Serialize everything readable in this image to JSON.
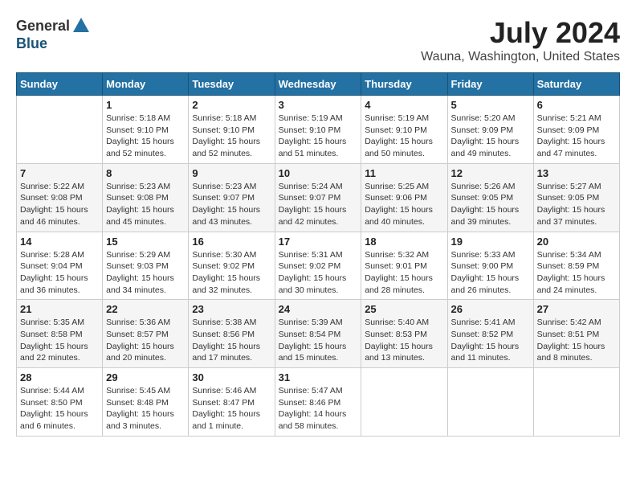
{
  "header": {
    "logo_general": "General",
    "logo_blue": "Blue",
    "month_title": "July 2024",
    "location": "Wauna, Washington, United States"
  },
  "weekdays": [
    "Sunday",
    "Monday",
    "Tuesday",
    "Wednesday",
    "Thursday",
    "Friday",
    "Saturday"
  ],
  "weeks": [
    [
      {
        "day": "",
        "info": ""
      },
      {
        "day": "1",
        "info": "Sunrise: 5:18 AM\nSunset: 9:10 PM\nDaylight: 15 hours\nand 52 minutes."
      },
      {
        "day": "2",
        "info": "Sunrise: 5:18 AM\nSunset: 9:10 PM\nDaylight: 15 hours\nand 52 minutes."
      },
      {
        "day": "3",
        "info": "Sunrise: 5:19 AM\nSunset: 9:10 PM\nDaylight: 15 hours\nand 51 minutes."
      },
      {
        "day": "4",
        "info": "Sunrise: 5:19 AM\nSunset: 9:10 PM\nDaylight: 15 hours\nand 50 minutes."
      },
      {
        "day": "5",
        "info": "Sunrise: 5:20 AM\nSunset: 9:09 PM\nDaylight: 15 hours\nand 49 minutes."
      },
      {
        "day": "6",
        "info": "Sunrise: 5:21 AM\nSunset: 9:09 PM\nDaylight: 15 hours\nand 47 minutes."
      }
    ],
    [
      {
        "day": "7",
        "info": "Sunrise: 5:22 AM\nSunset: 9:08 PM\nDaylight: 15 hours\nand 46 minutes."
      },
      {
        "day": "8",
        "info": "Sunrise: 5:23 AM\nSunset: 9:08 PM\nDaylight: 15 hours\nand 45 minutes."
      },
      {
        "day": "9",
        "info": "Sunrise: 5:23 AM\nSunset: 9:07 PM\nDaylight: 15 hours\nand 43 minutes."
      },
      {
        "day": "10",
        "info": "Sunrise: 5:24 AM\nSunset: 9:07 PM\nDaylight: 15 hours\nand 42 minutes."
      },
      {
        "day": "11",
        "info": "Sunrise: 5:25 AM\nSunset: 9:06 PM\nDaylight: 15 hours\nand 40 minutes."
      },
      {
        "day": "12",
        "info": "Sunrise: 5:26 AM\nSunset: 9:05 PM\nDaylight: 15 hours\nand 39 minutes."
      },
      {
        "day": "13",
        "info": "Sunrise: 5:27 AM\nSunset: 9:05 PM\nDaylight: 15 hours\nand 37 minutes."
      }
    ],
    [
      {
        "day": "14",
        "info": "Sunrise: 5:28 AM\nSunset: 9:04 PM\nDaylight: 15 hours\nand 36 minutes."
      },
      {
        "day": "15",
        "info": "Sunrise: 5:29 AM\nSunset: 9:03 PM\nDaylight: 15 hours\nand 34 minutes."
      },
      {
        "day": "16",
        "info": "Sunrise: 5:30 AM\nSunset: 9:02 PM\nDaylight: 15 hours\nand 32 minutes."
      },
      {
        "day": "17",
        "info": "Sunrise: 5:31 AM\nSunset: 9:02 PM\nDaylight: 15 hours\nand 30 minutes."
      },
      {
        "day": "18",
        "info": "Sunrise: 5:32 AM\nSunset: 9:01 PM\nDaylight: 15 hours\nand 28 minutes."
      },
      {
        "day": "19",
        "info": "Sunrise: 5:33 AM\nSunset: 9:00 PM\nDaylight: 15 hours\nand 26 minutes."
      },
      {
        "day": "20",
        "info": "Sunrise: 5:34 AM\nSunset: 8:59 PM\nDaylight: 15 hours\nand 24 minutes."
      }
    ],
    [
      {
        "day": "21",
        "info": "Sunrise: 5:35 AM\nSunset: 8:58 PM\nDaylight: 15 hours\nand 22 minutes."
      },
      {
        "day": "22",
        "info": "Sunrise: 5:36 AM\nSunset: 8:57 PM\nDaylight: 15 hours\nand 20 minutes."
      },
      {
        "day": "23",
        "info": "Sunrise: 5:38 AM\nSunset: 8:56 PM\nDaylight: 15 hours\nand 17 minutes."
      },
      {
        "day": "24",
        "info": "Sunrise: 5:39 AM\nSunset: 8:54 PM\nDaylight: 15 hours\nand 15 minutes."
      },
      {
        "day": "25",
        "info": "Sunrise: 5:40 AM\nSunset: 8:53 PM\nDaylight: 15 hours\nand 13 minutes."
      },
      {
        "day": "26",
        "info": "Sunrise: 5:41 AM\nSunset: 8:52 PM\nDaylight: 15 hours\nand 11 minutes."
      },
      {
        "day": "27",
        "info": "Sunrise: 5:42 AM\nSunset: 8:51 PM\nDaylight: 15 hours\nand 8 minutes."
      }
    ],
    [
      {
        "day": "28",
        "info": "Sunrise: 5:44 AM\nSunset: 8:50 PM\nDaylight: 15 hours\nand 6 minutes."
      },
      {
        "day": "29",
        "info": "Sunrise: 5:45 AM\nSunset: 8:48 PM\nDaylight: 15 hours\nand 3 minutes."
      },
      {
        "day": "30",
        "info": "Sunrise: 5:46 AM\nSunset: 8:47 PM\nDaylight: 15 hours\nand 1 minute."
      },
      {
        "day": "31",
        "info": "Sunrise: 5:47 AM\nSunset: 8:46 PM\nDaylight: 14 hours\nand 58 minutes."
      },
      {
        "day": "",
        "info": ""
      },
      {
        "day": "",
        "info": ""
      },
      {
        "day": "",
        "info": ""
      }
    ]
  ]
}
